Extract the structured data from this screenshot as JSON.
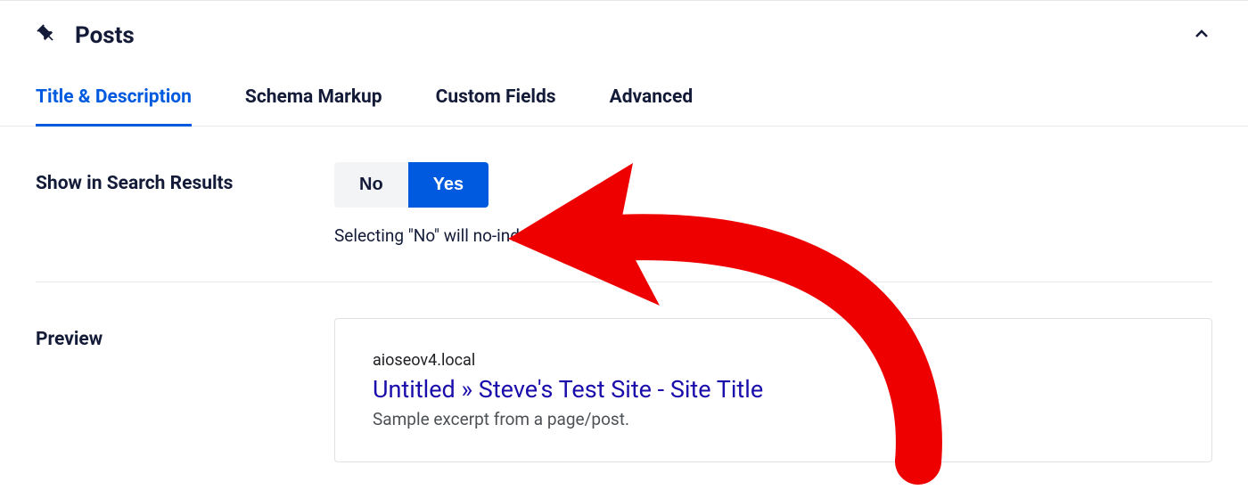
{
  "panel": {
    "title": "Posts"
  },
  "tabs": [
    {
      "label": "Title & Description",
      "active": true
    },
    {
      "label": "Schema Markup",
      "active": false
    },
    {
      "label": "Custom Fields",
      "active": false
    },
    {
      "label": "Advanced",
      "active": false
    }
  ],
  "settings": {
    "show_in_search": {
      "label": "Show in Search Results",
      "no_label": "No",
      "yes_label": "Yes",
      "helper": "Selecting \"No\" will no-index this page."
    },
    "preview": {
      "label": "Preview",
      "domain": "aioseov4.local",
      "title": "Untitled » Steve's Test Site - Site Title",
      "description": "Sample excerpt from a page/post."
    }
  }
}
